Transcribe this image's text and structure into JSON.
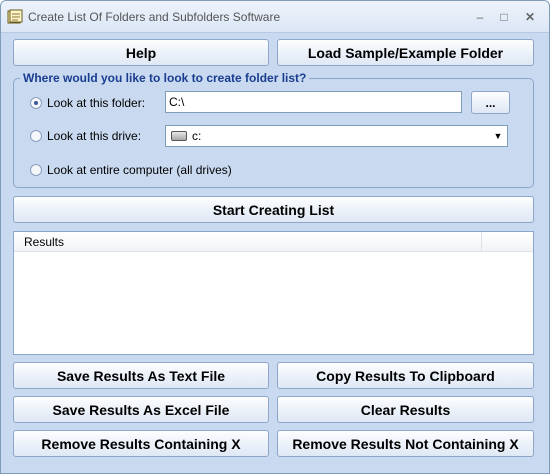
{
  "window": {
    "title": "Create List Of Folders and Subfolders Software",
    "min_glyph": "–",
    "max_glyph": "□",
    "close_glyph": "✕"
  },
  "buttons": {
    "help": "Help",
    "load_sample": "Load Sample/Example Folder",
    "browse": "...",
    "start": "Start Creating List",
    "save_text": "Save Results As Text File",
    "copy_clipboard": "Copy Results To Clipboard",
    "save_excel": "Save Results As Excel File",
    "clear": "Clear Results",
    "remove_containing": "Remove Results Containing X",
    "remove_not_containing": "Remove Results Not Containing X"
  },
  "group": {
    "legend": "Where would you like to look to create folder list?",
    "options": [
      {
        "label": "Look at this folder:",
        "selected": true
      },
      {
        "label": "Look at this drive:",
        "selected": false
      },
      {
        "label": "Look at entire computer (all drives)",
        "selected": false
      }
    ],
    "folder_value": "C:\\",
    "drive_value": "c:"
  },
  "results": {
    "column_header": "Results",
    "rows": []
  },
  "icons": {
    "app": "app-icon",
    "drive": "hard-drive-icon",
    "dropdown": "chevron-down-icon"
  },
  "colors": {
    "window_bg": "#c9daf0",
    "legend_text": "#1a3d8f",
    "border": "#8aa6cc"
  }
}
